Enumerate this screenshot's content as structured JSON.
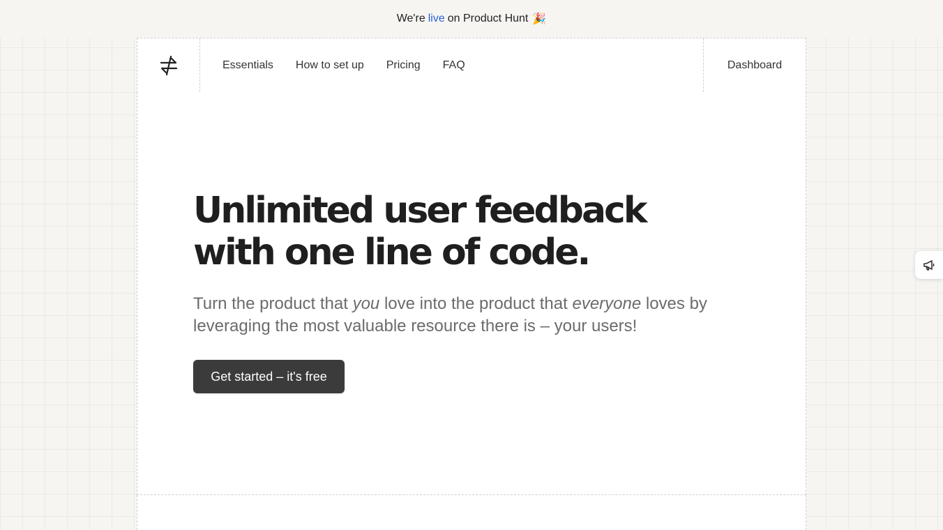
{
  "announcement": {
    "prefix": "We're",
    "highlight": "live",
    "suffix": "on Product Hunt",
    "emoji": "🎉",
    "highlight_color": "#2c5fd6"
  },
  "nav": {
    "logo_icon": "arrows-exchange-icon",
    "links": [
      {
        "label": "Essentials"
      },
      {
        "label": "How to set up"
      },
      {
        "label": "Pricing"
      },
      {
        "label": "FAQ"
      }
    ],
    "dashboard_label": "Dashboard"
  },
  "hero": {
    "title_line1": "Unlimited user feedback",
    "title_line2": "with one line of code.",
    "sub_part1": "Turn the product that",
    "sub_em1": "you",
    "sub_part2": "love into the product that",
    "sub_em2": "everyone",
    "sub_part3": "loves by leveraging the most valuable resource there is – your users!",
    "cta_label": "Get started – it's free"
  },
  "feedback_tab": {
    "icon": "megaphone-icon"
  },
  "colors": {
    "page_bg": "#f6f5f2",
    "button_bg": "#3b3b3b",
    "text_dark": "#1f1f1f",
    "text_muted": "#6b6b6b"
  }
}
